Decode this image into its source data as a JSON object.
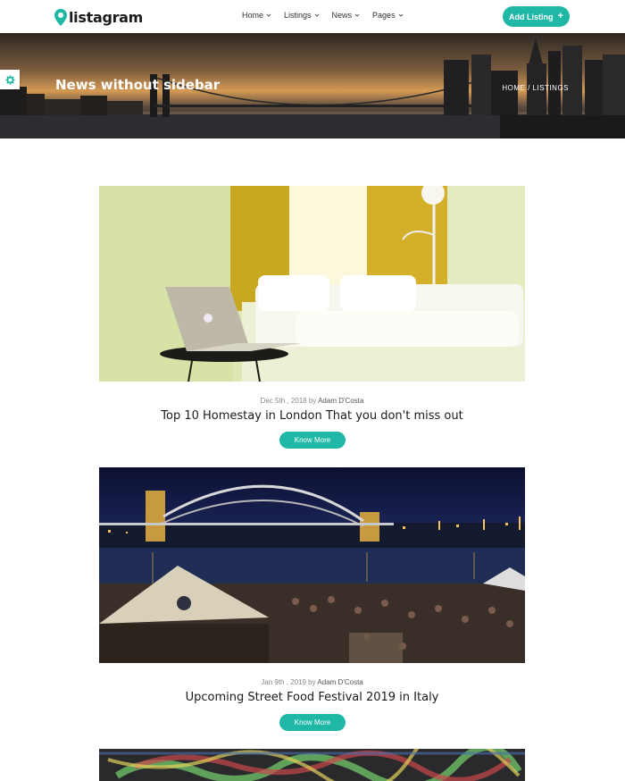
{
  "brand": {
    "name": "listagram",
    "accent": "#1fb7a6"
  },
  "nav": {
    "items": [
      {
        "label": "Home"
      },
      {
        "label": "Listings"
      },
      {
        "label": "News"
      },
      {
        "label": "Pages"
      }
    ],
    "add_listing_label": "Add Listing",
    "add_icon": "+"
  },
  "hero": {
    "title": "News without sidebar",
    "breadcrumb": "HOME / LISTINGS"
  },
  "posts": [
    {
      "date": "Dec 5th , 2018 by",
      "author": "Adam D'Costa",
      "title": "Top 10 Homestay in London That you don't miss out",
      "button": "Know More",
      "image": "hotel-room-photo"
    },
    {
      "date": "Jan 9th , 2019 by",
      "author": "Adam D'Costa",
      "title": "Upcoming Street Food Festival 2019 in Italy",
      "button": "Know More",
      "image": "sydney-harbour-night-photo"
    },
    {
      "image": "graffiti-wall-photo"
    }
  ]
}
